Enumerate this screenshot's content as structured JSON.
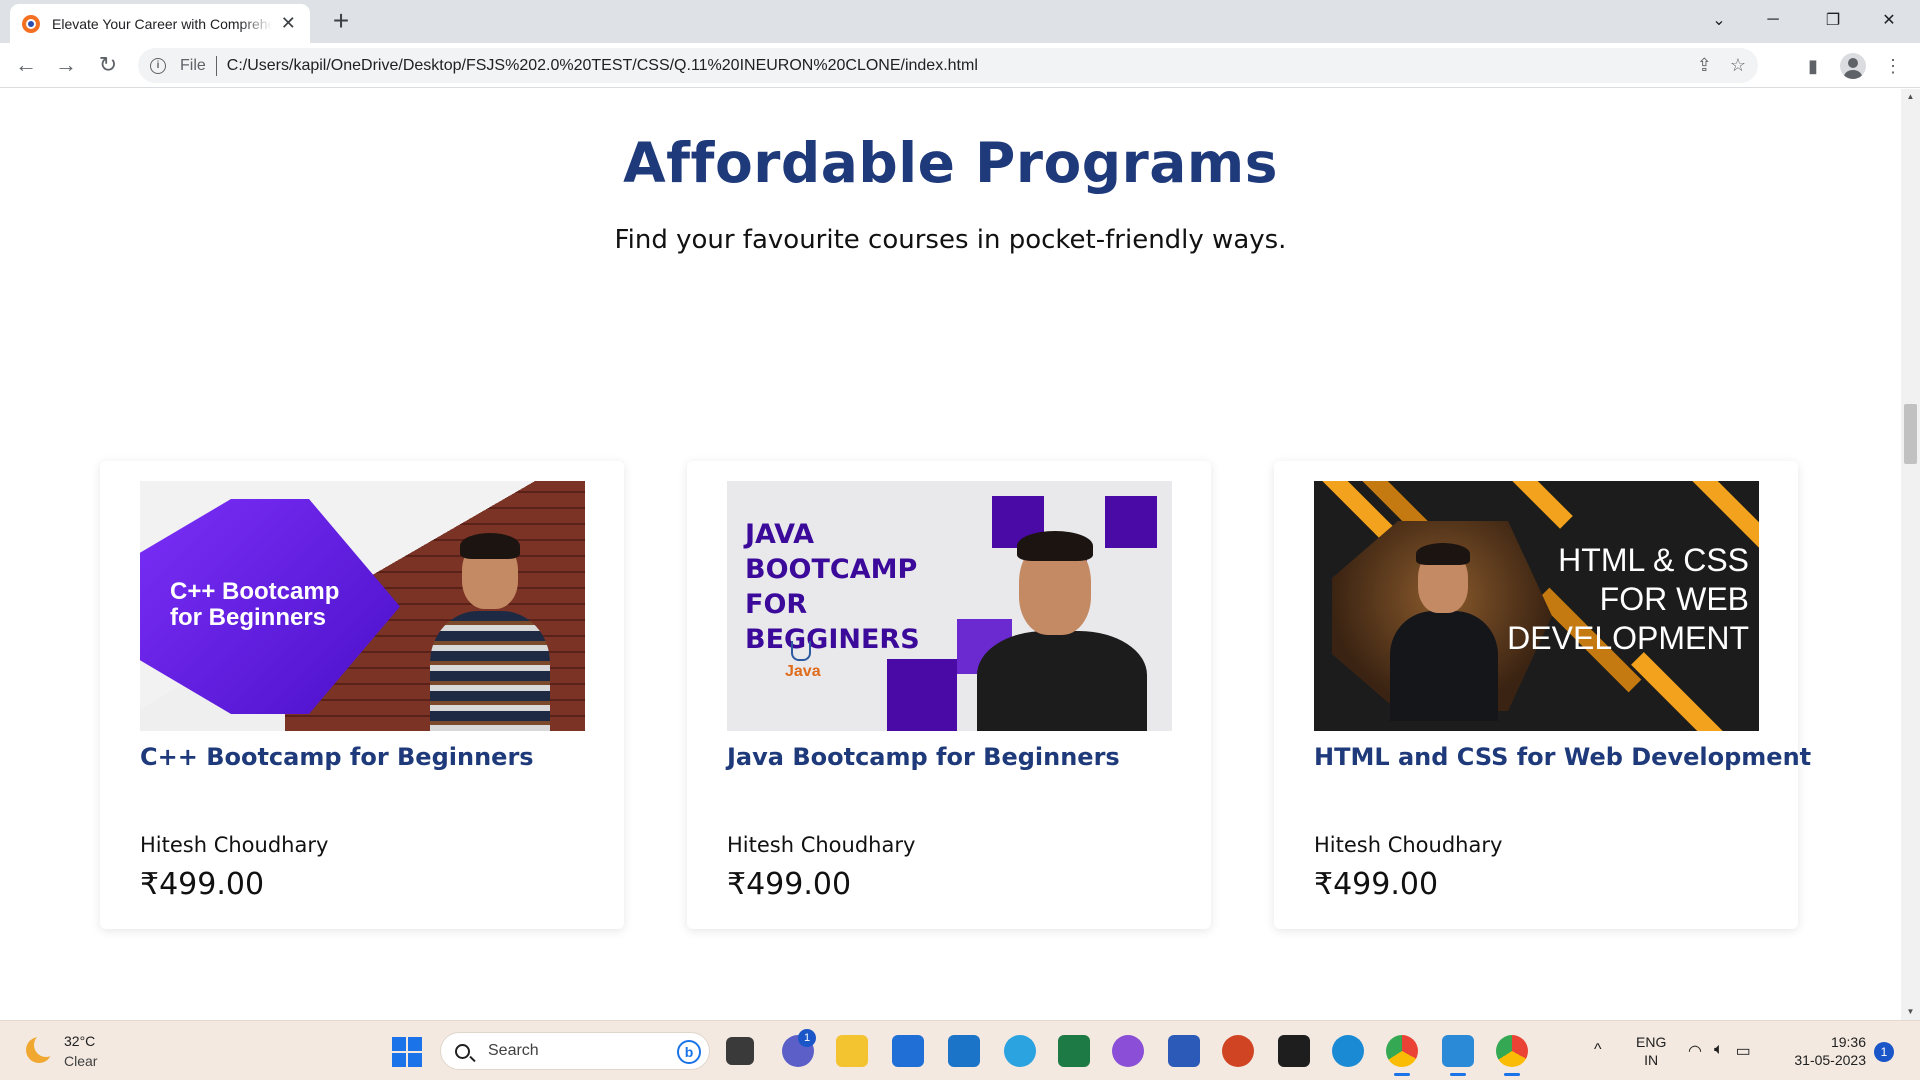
{
  "browser": {
    "tab_title": "Elevate Your Career with Comprehensive",
    "tab_close": "✕",
    "new_tab": "+",
    "omnibox_scheme": "File",
    "url": "C:/Users/kapil/OneDrive/Desktop/FSJS%202.0%20TEST/CSS/Q.11%20INEURON%20CLONE/index.html"
  },
  "page": {
    "section_title": "Affordable Programs",
    "section_subtitle": "Find your favourite courses in pocket-friendly ways.",
    "courses": [
      {
        "title": "C++ Bootcamp for Beginners",
        "author": "Hitesh Choudhary",
        "price": "₹499.00",
        "thumb_text_line1": "C++ Bootcamp",
        "thumb_text_line2": "for Beginners"
      },
      {
        "title": "Java Bootcamp for Beginners",
        "author": "Hitesh Choudhary",
        "price": "₹499.00",
        "thumb_text_lines": [
          "JAVA",
          "BOOTCAMP",
          "FOR",
          "BEGGINERS"
        ],
        "thumb_logo": "Java"
      },
      {
        "title": "HTML and CSS for Web Development",
        "author": "Hitesh Choudhary",
        "price": "₹499.00",
        "thumb_text_lines": [
          "HTML & CSS",
          "FOR WEB",
          "DEVELOPMENT"
        ]
      }
    ]
  },
  "taskbar": {
    "weather_temp": "32°C",
    "weather_condition": "Clear",
    "search_placeholder": "Search",
    "chat_badge": "1",
    "language_line1": "ENG",
    "language_line2": "IN",
    "time": "19:36",
    "date": "31-05-2023",
    "notification_count": "1"
  },
  "colors": {
    "heading": "#1f3a7a",
    "tabstrip": "#dee1e6",
    "taskbar": "#f3e9e0"
  }
}
